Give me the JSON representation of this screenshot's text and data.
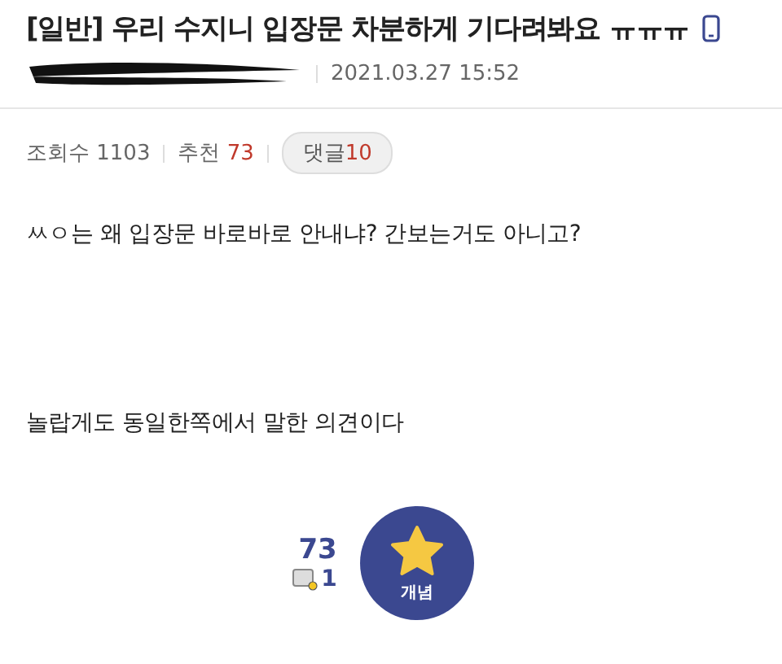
{
  "post": {
    "category": "[일반]",
    "title": "우리 수지니 입장문 차분하게 기다려봐요 ㅠㅠㅠ",
    "mobile": true,
    "date": "2021.03.27 15:52",
    "author_redacted": true
  },
  "stats": {
    "views_label": "조회수",
    "views": "1103",
    "recommend_label": "추천",
    "recommend": "73",
    "comments_label": "댓글",
    "comments": "10"
  },
  "body": [
    "ㅆㅇ는 왜 입장문 바로바로 안내냐? 간보는거도 아니고?",
    "놀랍게도 동일한쪽에서 말한 의견이다"
  ],
  "vote": {
    "count": "73",
    "fixed_count": "1",
    "button_label": "개념"
  }
}
